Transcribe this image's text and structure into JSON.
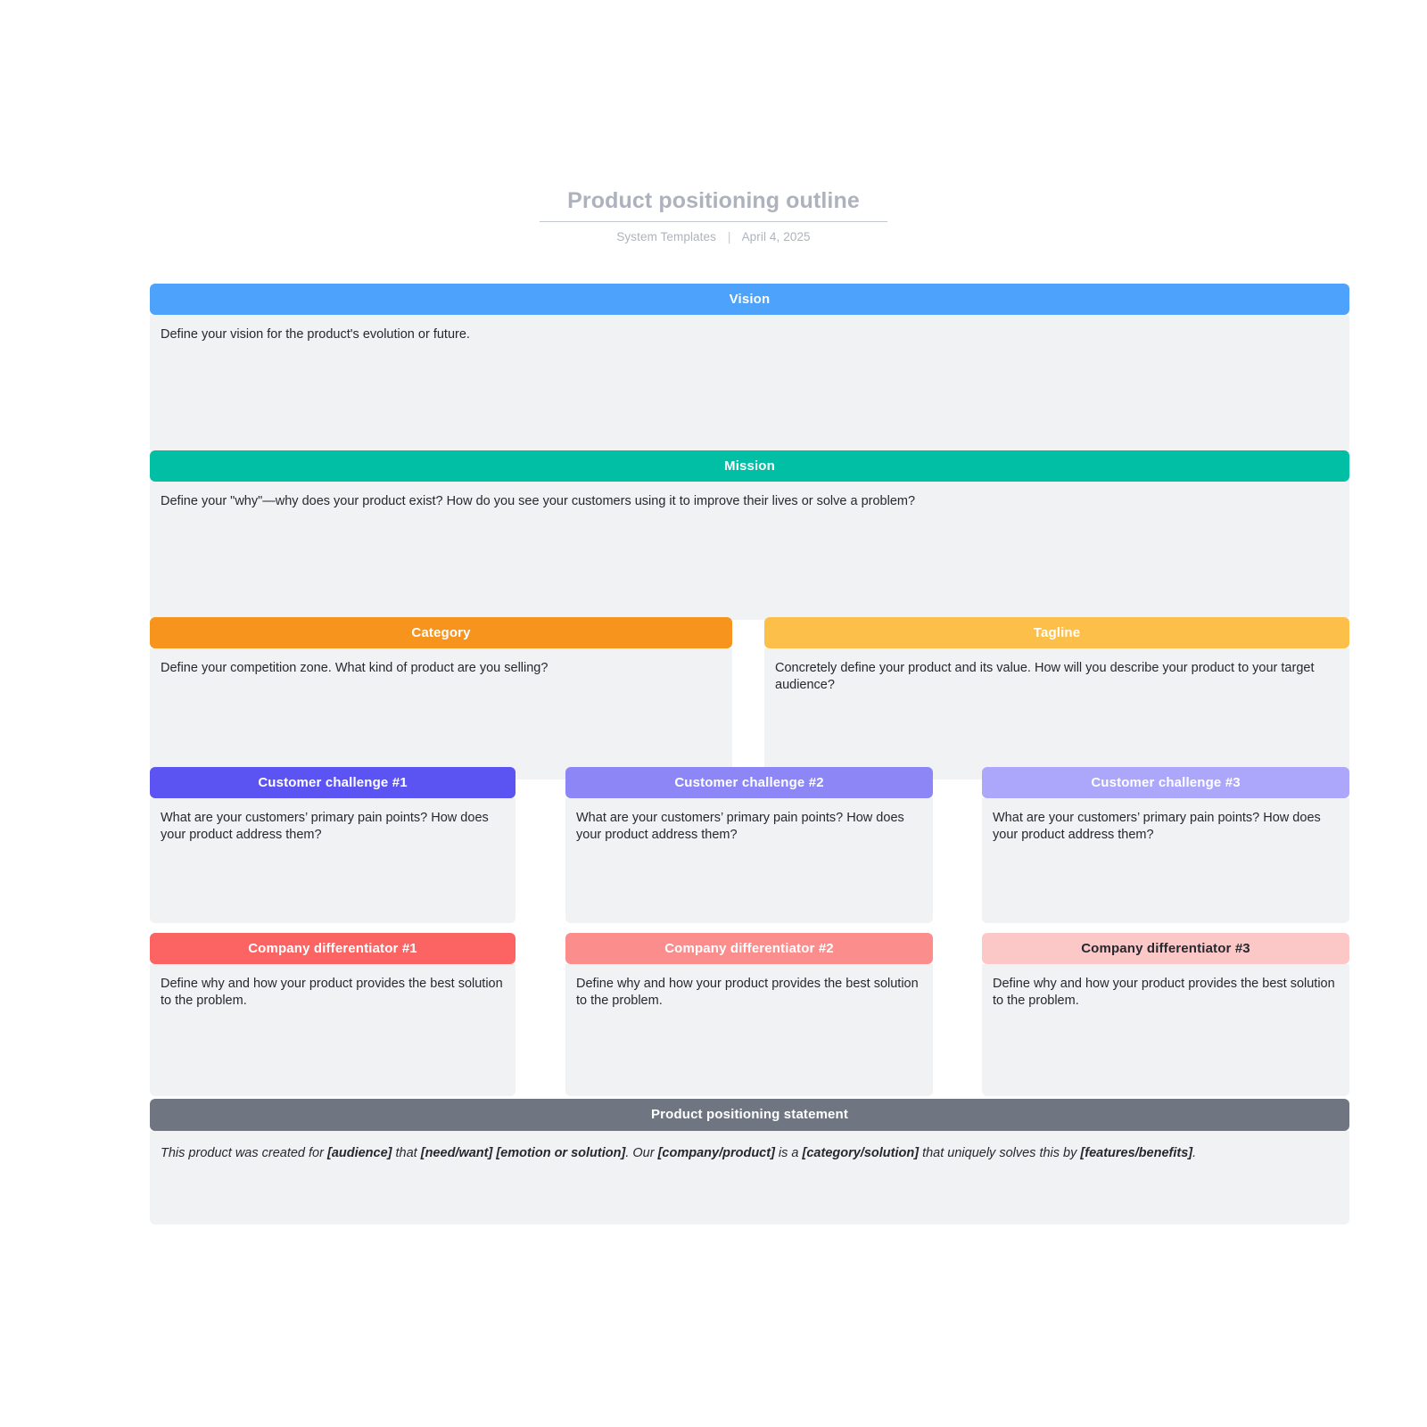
{
  "document": {
    "title": "Product positioning outline",
    "author": "System Templates",
    "separator": "|",
    "date": "April 4, 2025"
  },
  "colors": {
    "vision": "#4da2fc",
    "mission": "#00bfa5",
    "category": "#f7941e",
    "tagline": "#fcbf49",
    "challenge_1": "#5b54f2",
    "challenge_2": "#8c86f7",
    "challenge_3": "#aca7fa",
    "differentiator_1": "#fc6464",
    "differentiator_2": "#fc8d8d",
    "differentiator_3": "#fcc7c7",
    "statement": "#6f7682",
    "body_background": "#f1f2f4",
    "page_background": "#ffffff",
    "title_text": "#adb2bd"
  },
  "sections": {
    "vision": {
      "heading": "Vision",
      "prompt": "Define your vision for the product's evolution or future."
    },
    "mission": {
      "heading": "Mission",
      "prompt": "Define your \"why\"—why does your product exist? How do you see your customers using it to improve their lives or solve a problem?"
    },
    "category": {
      "heading": "Category",
      "prompt": "Define your competition zone. What kind of product are you selling?"
    },
    "tagline": {
      "heading": "Tagline",
      "prompt": "Concretely define your product and its value. How will you describe your product to your target audience?"
    },
    "challenges": [
      {
        "heading": "Customer challenge #1",
        "prompt": "What are your customers’ primary pain points? How does your product address them?"
      },
      {
        "heading": "Customer challenge #2",
        "prompt": "What are your customers’ primary pain points? How does your product address them?"
      },
      {
        "heading": "Customer challenge #3",
        "prompt": "What are your customers’ primary pain points? How does your product address them?"
      }
    ],
    "differentiators": [
      {
        "heading": "Company differentiator #1",
        "prompt": "Define why and how your product provides the best solution to the problem."
      },
      {
        "heading": "Company differentiator #2",
        "prompt": "Define why and how your product provides the best solution to the problem."
      },
      {
        "heading": "Company differentiator #3",
        "prompt": "Define why and how your product provides the best solution to the problem."
      }
    ],
    "statement": {
      "heading": "Product positioning statement",
      "parts": {
        "p1": "This product was created for ",
        "b1": "[audience]",
        "p2": " that ",
        "b2": "[need/want] [emotion or solution]",
        "p3": ". Our ",
        "b3": "[company/product]",
        "p4": " is a ",
        "b4": "[category/solution]",
        "p5": " that uniquely solves this by ",
        "b5": "[features/benefits]",
        "p6": "."
      }
    }
  }
}
